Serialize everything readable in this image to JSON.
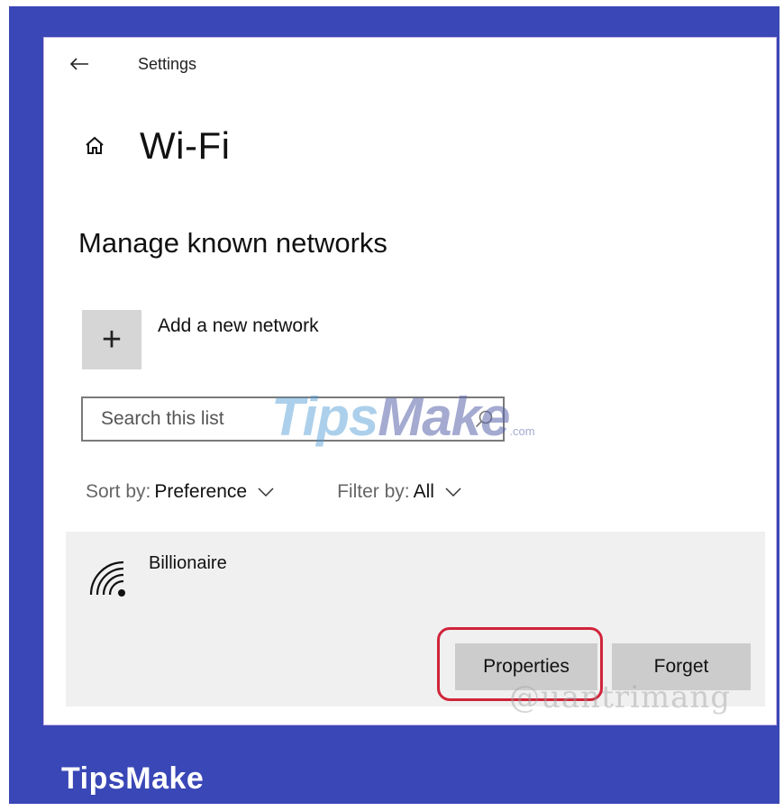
{
  "header": {
    "back_label": "←",
    "app_title": "Settings"
  },
  "page": {
    "title": "Wi-Fi",
    "section_title": "Manage known networks"
  },
  "add_network": {
    "icon_glyph": "+",
    "label": "Add a new network"
  },
  "search": {
    "placeholder": "Search this list",
    "value": ""
  },
  "sort": {
    "label": "Sort by:",
    "value": "Preference"
  },
  "filter": {
    "label": "Filter by:",
    "value": "All"
  },
  "networks": [
    {
      "name": "Billionaire",
      "icon": "wifi-icon",
      "buttons": {
        "properties": "Properties",
        "forget": "Forget"
      }
    }
  ],
  "watermarks": {
    "center_part1": "T",
    "center_part2": "ips",
    "center_part3": "Make",
    "center_suffix": ".com",
    "corner": "@uantrimang"
  },
  "brand": {
    "label": "TipsMake"
  },
  "colors": {
    "frame": "#3a47b6",
    "highlight": "#d0243a",
    "button_bg": "#cccccc",
    "card_bg": "#f0f0f0"
  }
}
